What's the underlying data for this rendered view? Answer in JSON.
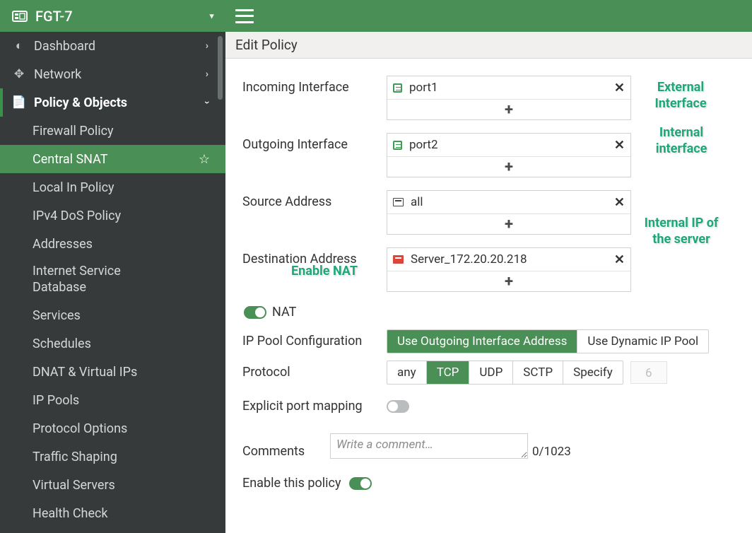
{
  "device_name": "FGT-7",
  "nav": {
    "dashboard": "Dashboard",
    "network": "Network",
    "policy_objects": "Policy & Objects",
    "items": [
      "Firewall Policy",
      "Central SNAT",
      "Local In Policy",
      "IPv4 DoS Policy",
      "Addresses",
      "Internet Service Database",
      "Services",
      "Schedules",
      "DNAT & Virtual IPs",
      "IP Pools",
      "Protocol Options",
      "Traffic Shaping",
      "Virtual Servers",
      "Health Check"
    ]
  },
  "page_title": "Edit Policy",
  "labels": {
    "incoming_if": "Incoming Interface",
    "outgoing_if": "Outgoing Interface",
    "src_addr": "Source Address",
    "dst_addr": "Destination Address",
    "nat": "NAT",
    "ip_pool_cfg": "IP Pool Configuration",
    "protocol": "Protocol",
    "explicit_port": "Explicit port mapping",
    "comments": "Comments",
    "enable_policy": "Enable this policy"
  },
  "values": {
    "incoming_if": "port1",
    "outgoing_if": "port2",
    "src_addr": "all",
    "dst_addr": "Server_172.20.20.218",
    "proto_placeholder": "6",
    "comments_placeholder": "Write a comment…",
    "char_count": "0/1023"
  },
  "ip_pool_options": {
    "use_outgoing": "Use Outgoing Interface Address",
    "use_dynamic": "Use Dynamic IP Pool"
  },
  "proto_options": {
    "any": "any",
    "tcp": "TCP",
    "udp": "UDP",
    "sctp": "SCTP",
    "specify": "Specify"
  },
  "annotations": {
    "ext_if": "External Interface",
    "int_if": "Internal interface",
    "int_ip": "Internal IP of the server",
    "enable_nat": "Enable NAT"
  }
}
